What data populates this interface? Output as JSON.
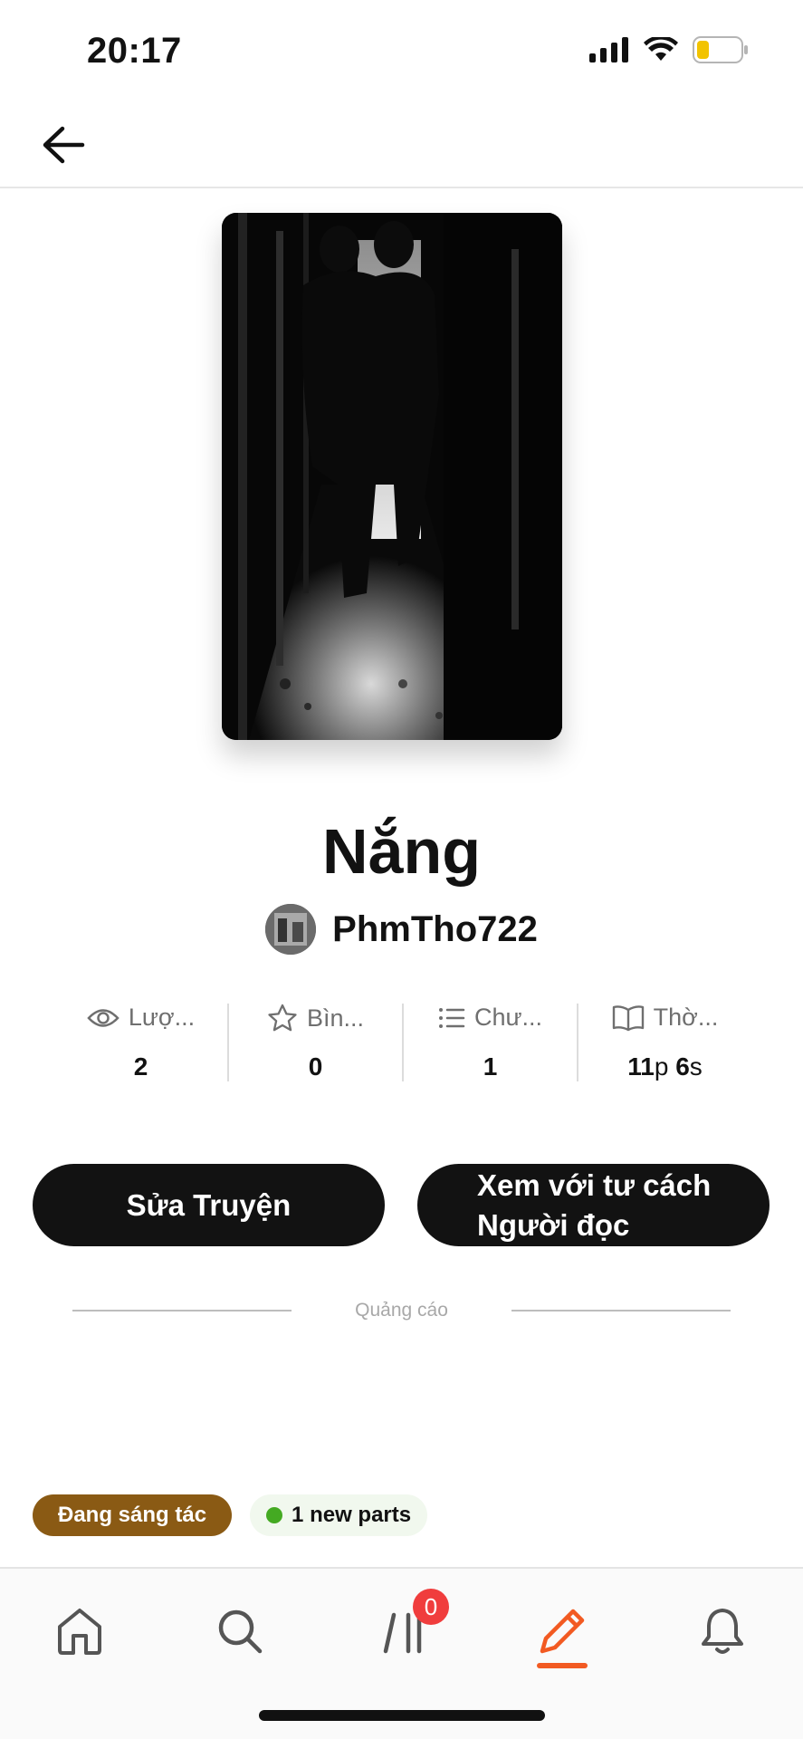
{
  "status_bar": {
    "time": "20:17",
    "battery_level": 0.2
  },
  "header": {
    "back_icon": "arrow-left-icon"
  },
  "story": {
    "title": "Nắng",
    "author": "PhmTho722"
  },
  "stats": [
    {
      "icon": "eye-icon",
      "label": "Lượ...",
      "value": "2"
    },
    {
      "icon": "star-icon",
      "label": "Bìn...",
      "value": "0"
    },
    {
      "icon": "list-icon",
      "label": "Chư...",
      "value": "1"
    },
    {
      "icon": "book-icon",
      "label": "Thờ...",
      "value_num1": "11",
      "value_unit1": "p",
      "value_num2": "6",
      "value_unit2": "s"
    }
  ],
  "buttons": {
    "edit": "Sửa Truyện",
    "reader_line1": "Xem với tư cách",
    "reader_line2": "Người đọc"
  },
  "ad": {
    "label": "Quảng cáo"
  },
  "tags": {
    "status": "Đang sáng tác",
    "new_parts": "1 new parts"
  },
  "bottom_nav": {
    "items": [
      "home-icon",
      "search-icon",
      "library-icon",
      "write-icon",
      "bell-icon"
    ],
    "library_badge": "0",
    "active": "write-icon"
  },
  "colors": {
    "accent": "#f25a22",
    "status_tag": "#8a5a14",
    "button": "#121212",
    "badge": "#f03d3d"
  }
}
